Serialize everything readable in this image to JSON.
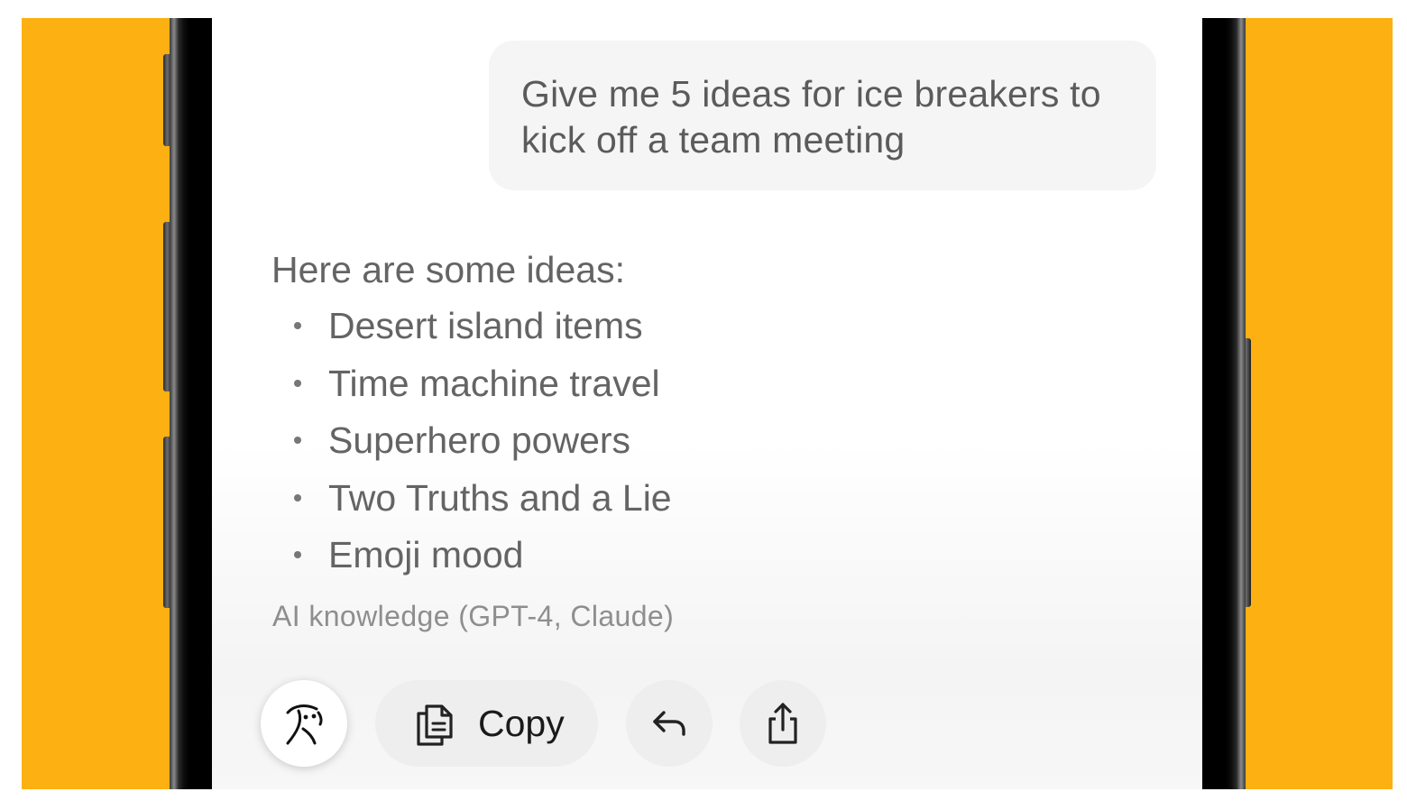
{
  "colors": {
    "background_accent": "#FDB011",
    "phone_bezel": "#000000",
    "bubble": "#F5F5F5",
    "action_button": "#EEEEEE"
  },
  "conversation": {
    "user_message": "Give me 5 ideas for ice breakers to kick off a team meeting",
    "assistant": {
      "intro": "Here are some ideas:",
      "ideas": [
        "Desert island items",
        "Time machine travel",
        "Superhero powers",
        "Two Truths and a Lie",
        "Emoji mood"
      ],
      "source": "AI knowledge (GPT-4, Claude)"
    }
  },
  "actions": {
    "persona_icon": "persona-face-icon",
    "copy_label": "Copy",
    "copy_icon": "copy-icon",
    "reply_icon": "reply-arrow-icon",
    "share_icon": "share-icon"
  }
}
